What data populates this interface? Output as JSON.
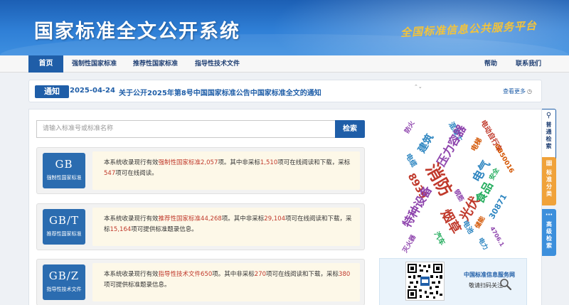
{
  "header": {
    "title": "国家标准全文公开系统",
    "slogan": "全国标准信息公共服务平台"
  },
  "nav": {
    "home": "首页",
    "mandatory": "强制性国家标准",
    "recommended": "推荐性国家标准",
    "guidance": "指导性技术文件",
    "help": "帮助",
    "contact": "联系我们"
  },
  "notice": {
    "tag": "通知",
    "date": "2025-04-24",
    "text": "关于公开2025年第8号中国国家标准公告中国家标准全文的通知",
    "arrows": "⌃⌄",
    "more": "查看更多",
    "clock_icon": "clock-icon"
  },
  "search": {
    "placeholder": "请输入标准号或标准名称",
    "button": "检索"
  },
  "standards": [
    {
      "code": "GB",
      "label": "强制性国家标准",
      "d1": "本系统收录现行有效",
      "d1_link": "强制性国家标准",
      "d1_count": "2,057",
      "d2": "项。其中非采标",
      "d2_count": "1,510",
      "d3": "项可在线阅读和下载，采标",
      "d3_count": "547",
      "d4": "项可在线阅读。"
    },
    {
      "code": "GB/T",
      "label": "推荐性国家标准",
      "d1": "本系统收录现行有效",
      "d1_link": "推荐性国家标准",
      "d1_count": "44,268",
      "d2": "项。其中非采标",
      "d2_count": "29,104",
      "d3": "项可在线阅读和下载，采标",
      "d3_count": "15,164",
      "d4": "项可提供标准题录信息。"
    },
    {
      "code": "GB/Z",
      "label": "指导性技术文件",
      "d1": "本系统收录现行有效",
      "d1_link": "指导性技术文件",
      "d1_count": "650",
      "d2": "项。其中非采标",
      "d2_count": "270",
      "d3": "项可在线阅读和下载，采标",
      "d3_count": "380",
      "d4": "项可提供标准题录信息。"
    }
  ],
  "word_cloud": [
    {
      "text": "防火",
      "color": "#8e44ad"
    },
    {
      "text": "混凝土",
      "color": "#2e86c1"
    },
    {
      "text": "电动自行车",
      "color": "#c0392b"
    },
    {
      "text": "建筑",
      "color": "#2e86c1"
    },
    {
      "text": "压力容器",
      "color": "#8e44ad"
    },
    {
      "text": "电梯",
      "color": "#d35400"
    },
    {
      "text": "GB50016",
      "color": "#d35400"
    },
    {
      "text": "电缆",
      "color": "#2e86c1"
    },
    {
      "text": "消防",
      "color": "#c0392b"
    },
    {
      "text": "电气",
      "color": "#2e86c1"
    },
    {
      "text": "安全",
      "color": "#27ae60"
    },
    {
      "text": "8939",
      "color": "#c0392b"
    },
    {
      "text": "钢筋",
      "color": "#8e44ad"
    },
    {
      "text": "食品",
      "color": "#27ae60"
    },
    {
      "text": "特种设备",
      "color": "#8e44ad"
    },
    {
      "text": "光伏",
      "color": "#c0392b"
    },
    {
      "text": "30871",
      "color": "#2e86c1"
    },
    {
      "text": "烟草",
      "color": "#c0392b"
    },
    {
      "text": "储能",
      "color": "#d35400"
    },
    {
      "text": "电池",
      "color": "#2e86c1"
    },
    {
      "text": "汽车",
      "color": "#27ae60"
    },
    {
      "text": "灭火器",
      "color": "#8e44ad"
    },
    {
      "text": "4706.1",
      "color": "#8e44ad"
    },
    {
      "text": "电力",
      "color": "#2e86c1"
    }
  ],
  "qr": {
    "title": "中国标准信息服务网",
    "subtitle": "敬请扫码关注",
    "icon": "magnifier-icon"
  },
  "side_tabs": {
    "basic": "普通检索",
    "category": "标准分类",
    "advanced": "高级检索"
  }
}
